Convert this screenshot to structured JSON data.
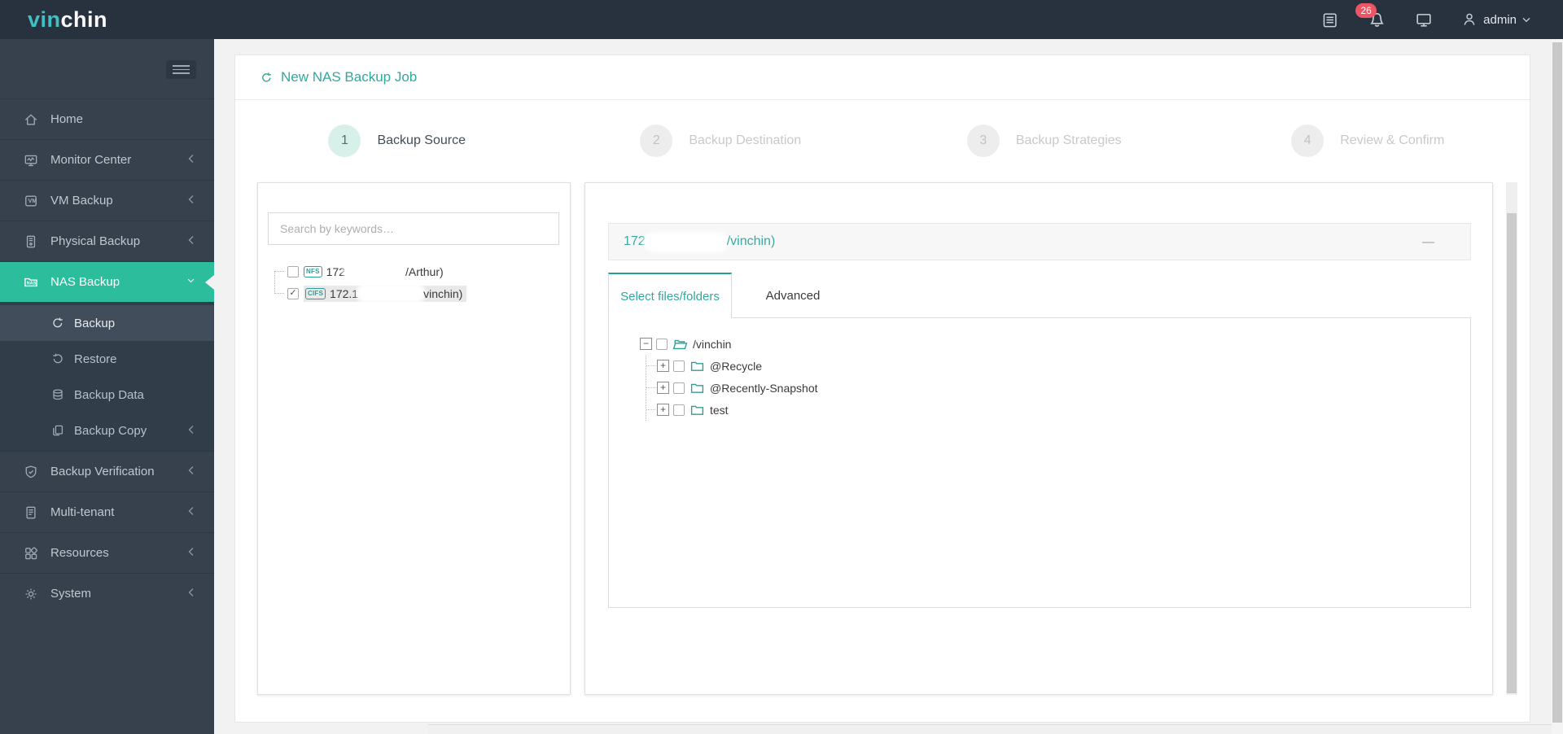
{
  "brand": {
    "logo_primary": "vin",
    "logo_secondary": "chin"
  },
  "topbar": {
    "notification_count": "26",
    "username": "admin"
  },
  "sidebar": {
    "items": [
      {
        "label": "Home"
      },
      {
        "label": "Monitor Center"
      },
      {
        "label": "VM Backup"
      },
      {
        "label": "Physical Backup"
      },
      {
        "label": "NAS Backup"
      },
      {
        "label": "Backup Verification"
      },
      {
        "label": "Multi-tenant"
      },
      {
        "label": "Resources"
      },
      {
        "label": "System"
      }
    ],
    "nas_submenu": [
      {
        "label": "Backup"
      },
      {
        "label": "Restore"
      },
      {
        "label": "Backup Data"
      },
      {
        "label": "Backup Copy"
      }
    ]
  },
  "wizard": {
    "title": "New NAS Backup Job",
    "steps": [
      {
        "num": "1",
        "label": "Backup Source"
      },
      {
        "num": "2",
        "label": "Backup Destination"
      },
      {
        "num": "3",
        "label": "Backup Strategies"
      },
      {
        "num": "4",
        "label": "Review & Confirm"
      }
    ]
  },
  "source_panel": {
    "search_placeholder": "Search by keywords…",
    "storages": [
      {
        "protocol": "NFS",
        "name_visible_start": "172",
        "name_visible_end": "/Arthur)",
        "checked": false
      },
      {
        "protocol": "CIFS",
        "name_visible_start": "172.1",
        "name_visible_end": "vinchin)",
        "checked": true
      }
    ]
  },
  "detail_panel": {
    "title_visible_start": "172",
    "title_visible_end": "/vinchin)",
    "minimize_glyph": "—",
    "tabs": [
      {
        "label": "Select files/folders"
      },
      {
        "label": "Advanced"
      }
    ],
    "file_tree": {
      "root_label": "/vinchin",
      "children": [
        {
          "label": "@Recycle"
        },
        {
          "label": "@Recently-Snapshot"
        },
        {
          "label": "test"
        }
      ]
    }
  },
  "glyphs": {
    "collapse": "−",
    "expand": "+",
    "check": "✓"
  },
  "colors": {
    "accent_teal": "#2BBD9C",
    "title_teal": "#2FA99E",
    "topbar_bg": "#28313E",
    "sidebar_bg": "#37414E",
    "badge_red": "#ED5565"
  }
}
